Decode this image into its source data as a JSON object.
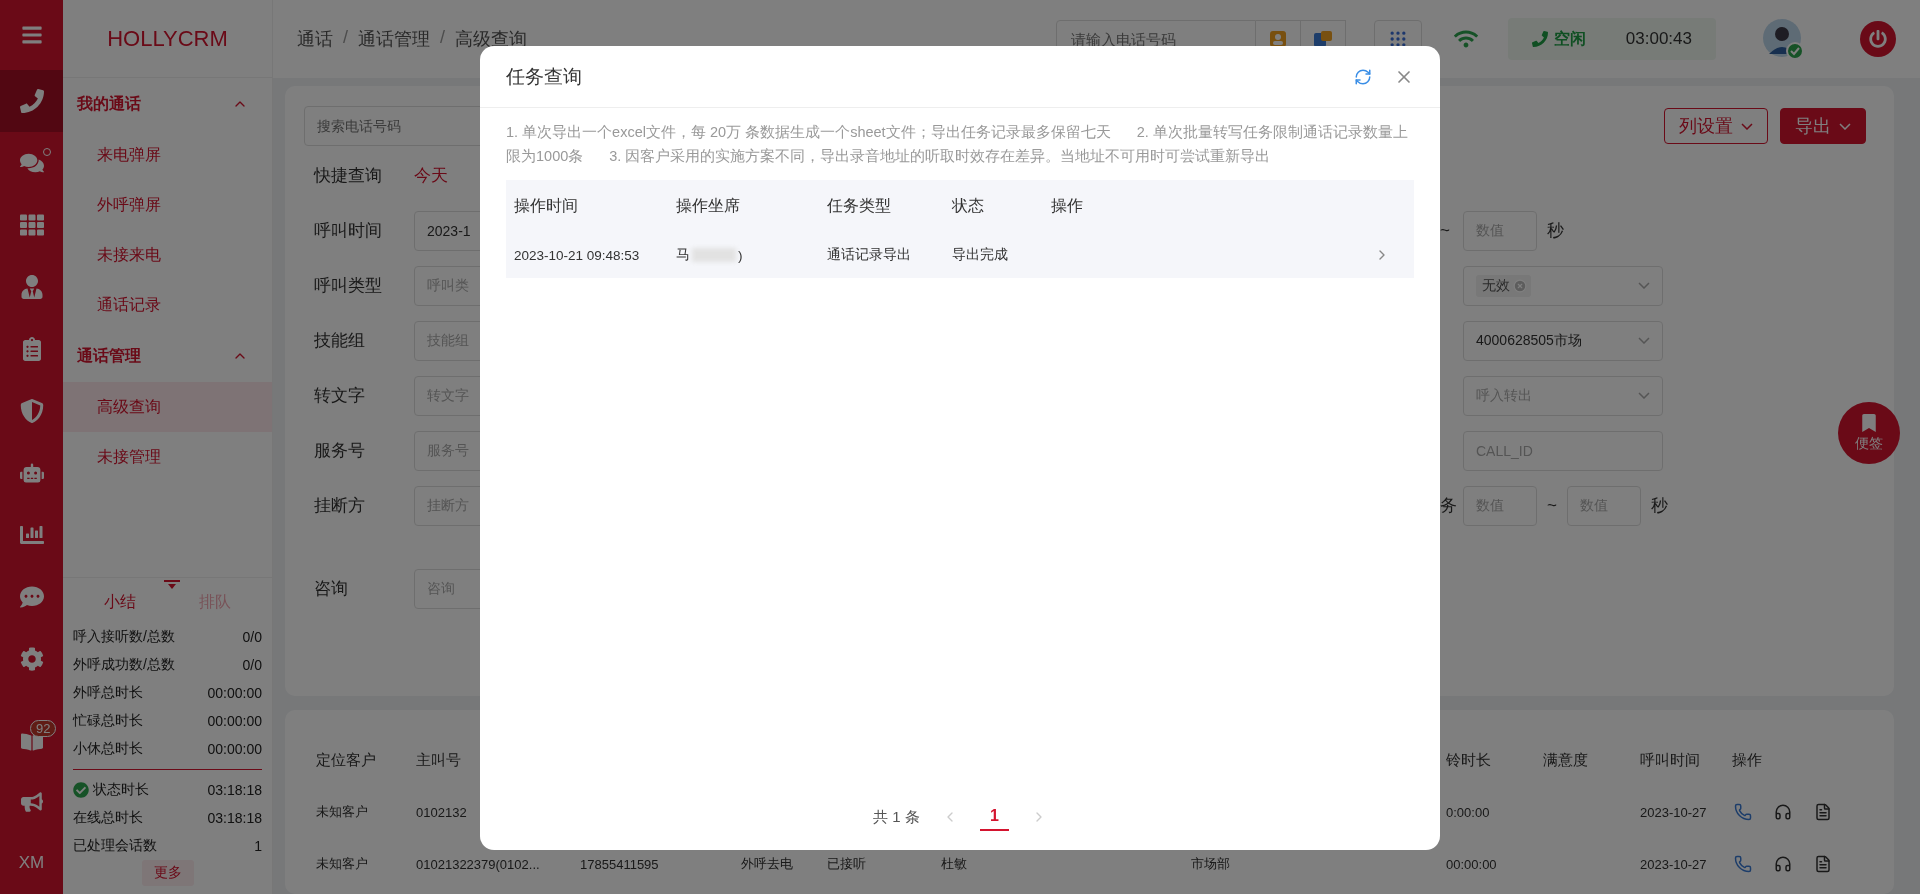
{
  "logo": "HOLLYCRM",
  "rail": {
    "items": [
      {
        "selected": false,
        "notice": false
      },
      {
        "selected": true,
        "notice": false
      },
      {
        "selected": false,
        "notice": true
      },
      {
        "selected": false,
        "notice": false
      },
      {
        "selected": false,
        "notice": false
      },
      {
        "selected": false,
        "notice": false
      },
      {
        "selected": false,
        "notice": false
      },
      {
        "selected": false,
        "notice": false
      },
      {
        "selected": false,
        "notice": false
      },
      {
        "selected": false,
        "notice": false
      },
      {
        "selected": false,
        "notice": false
      }
    ],
    "bottom_items": [
      {
        "kind": "book",
        "badge": "92"
      },
      {
        "kind": "megaphone"
      }
    ],
    "initials": "XM"
  },
  "nav": {
    "sections": [
      {
        "title": "我的通话",
        "expanded": true,
        "items": [
          {
            "label": "来电弹屏",
            "selected": false
          },
          {
            "label": "外呼弹屏",
            "selected": false
          },
          {
            "label": "未接来电",
            "selected": false
          },
          {
            "label": "通话记录",
            "selected": false
          }
        ]
      },
      {
        "title": "通话管理",
        "expanded": true,
        "items": [
          {
            "label": "高级查询",
            "selected": true
          },
          {
            "label": "未接管理",
            "selected": false
          }
        ]
      }
    ]
  },
  "summary": {
    "tabs": [
      {
        "label": "小结",
        "selected": true
      },
      {
        "label": "排队",
        "selected": false
      }
    ],
    "stats": [
      {
        "label": "呼入接听数/总数",
        "value": "0/0"
      },
      {
        "label": "外呼成功数/总数",
        "value": "0/0"
      },
      {
        "label": "外呼总时长",
        "value": "00:00:00"
      },
      {
        "label": "忙碌总时长",
        "value": "00:00:00"
      },
      {
        "label": "小休总时长",
        "value": "00:00:00"
      }
    ],
    "status_stats": [
      {
        "label": "状态时长",
        "value": "03:18:18",
        "ok": true
      },
      {
        "label": "在线总时长",
        "value": "03:18:18",
        "ok": false
      },
      {
        "label": "已处理会话数",
        "value": "1",
        "ok": false
      }
    ],
    "more": "更多"
  },
  "breadcrumb": [
    "通话",
    "通话管理",
    "高级查询"
  ],
  "breadcrumb_separator": "/",
  "topbar": {
    "search_placeholder": "请输入电话号码",
    "status": "空闲",
    "timer": "03:00:43",
    "online": true
  },
  "filters": {
    "search_placeholder": "搜索电话号码",
    "quick_label": "快捷查询",
    "quick_option": "今天",
    "column_settings": "列设置",
    "export": "导出",
    "rows": [
      {
        "label": "呼叫时间",
        "value": "2023-1",
        "right": {
          "kind": "range_end",
          "separator": "~",
          "placeholder": "数值",
          "unit": "秒"
        }
      },
      {
        "label": "呼叫类型",
        "placeholder": "呼叫类",
        "right": {
          "kind": "tag_select",
          "tag": "无效"
        }
      },
      {
        "label": "技能组",
        "placeholder": "技能组",
        "right": {
          "kind": "select",
          "value": "4000628505市场"
        }
      },
      {
        "label": "转文字",
        "placeholder": "转文字",
        "right": {
          "kind": "select",
          "placeholder": "呼入转出"
        }
      },
      {
        "label": "服务号",
        "placeholder": "服务号",
        "right": {
          "kind": "input",
          "placeholder": "CALL_ID"
        }
      },
      {
        "label": "挂断方",
        "placeholder": "挂断方",
        "right": {
          "kind": "range",
          "label": "务",
          "placeholder": "数值",
          "separator": "~",
          "placeholder_to": "数值",
          "unit": "秒"
        }
      }
    ],
    "last_row": {
      "label": "咨询",
      "placeholder": "咨询"
    }
  },
  "sticky_note": "便签",
  "table": {
    "columns": [
      "定位客户",
      "主叫号",
      null,
      null,
      null,
      null,
      null,
      "铃时长",
      "满意度",
      "呼叫时间"
    ],
    "actions_column": "操作",
    "rows": [
      [
        "未知客户",
        "0102132",
        null,
        null,
        null,
        null,
        null,
        "0:00:00",
        null,
        "2023-10-27"
      ],
      [
        "未知客户",
        "01021322379(0102...",
        "17855411595",
        "外呼去电",
        "已接听",
        "杜敏",
        "市场部",
        "00:00:00",
        null,
        "2023-10-27"
      ]
    ]
  },
  "modal": {
    "title": "任务查询",
    "notes": [
      "1. 单次导出一个excel文件，每 20万 条数据生成一个sheet文件；导出任务记录最多保留七天",
      "2. 单次批量转写任务限制通话记录数量上限为1000条",
      "3. 因客户采用的实施方案不同，导出录音地址的听取时效存在差异。当地址不可用时可尝试重新导出"
    ],
    "columns": [
      "操作时间",
      "操作坐席",
      "任务类型",
      "状态",
      "操作"
    ],
    "rows": [
      {
        "time": "2023-10-21 09:48:53",
        "agent": "马",
        "agent_suffix": ")",
        "type": "通话记录导出",
        "status": "导出完成"
      }
    ],
    "total": "共 1 条",
    "pages": [
      {
        "label": "1",
        "selected": true
      }
    ]
  }
}
